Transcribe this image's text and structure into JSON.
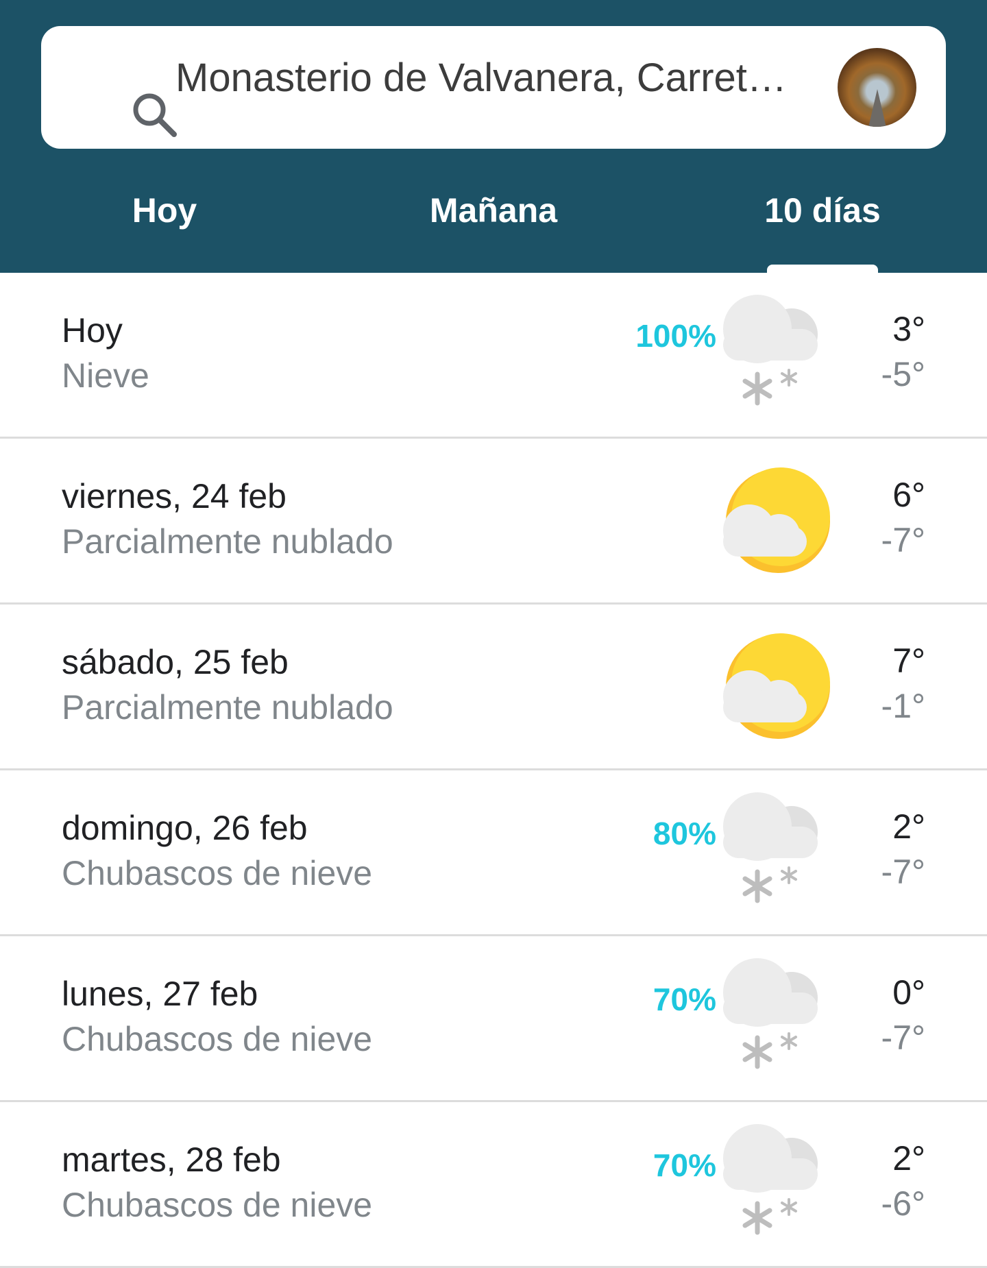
{
  "search": {
    "text": "Monasterio de Valvanera, Carret…"
  },
  "tabs": [
    {
      "label": "Hoy"
    },
    {
      "label": "Mañana"
    },
    {
      "label": "10 días"
    }
  ],
  "forecast": [
    {
      "day": "Hoy",
      "desc": "Nieve",
      "precip": "100%",
      "icon": "snow-icon",
      "hi": "3°",
      "lo": "-5°"
    },
    {
      "day": "viernes, 24 feb",
      "desc": "Parcialmente nublado",
      "precip": "",
      "icon": "partly-cloudy-icon",
      "hi": "6°",
      "lo": "-7°"
    },
    {
      "day": "sábado, 25 feb",
      "desc": "Parcialmente nublado",
      "precip": "",
      "icon": "partly-cloudy-icon",
      "hi": "7°",
      "lo": "-1°"
    },
    {
      "day": "domingo, 26 feb",
      "desc": "Chubascos de nieve",
      "precip": "80%",
      "icon": "snow-icon",
      "hi": "2°",
      "lo": "-7°"
    },
    {
      "day": "lunes, 27 feb",
      "desc": "Chubascos de nieve",
      "precip": "70%",
      "icon": "snow-icon",
      "hi": "0°",
      "lo": "-7°"
    },
    {
      "day": "martes, 28 feb",
      "desc": "Chubascos de nieve",
      "precip": "70%",
      "icon": "snow-icon",
      "hi": "2°",
      "lo": "-6°"
    }
  ],
  "colors": {
    "header": "#1c5266",
    "precip": "#1ec6dd",
    "sun": "#fbc02d"
  }
}
